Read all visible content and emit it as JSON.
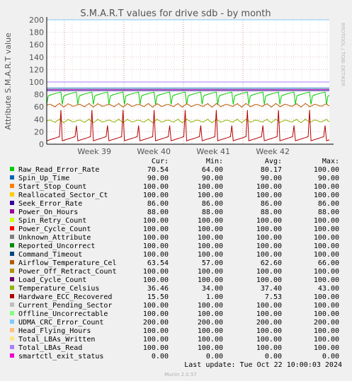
{
  "chart_data": {
    "type": "line",
    "title": "S.M.A.R.T values for drive sdb - by month",
    "ylabel": "Attribute S.M.A.R.T value",
    "watermark": "RRDTOOL / TOBI OETIKER",
    "ylim": [
      0,
      200
    ],
    "yticks": [
      0,
      20,
      40,
      60,
      80,
      100,
      120,
      140,
      160,
      180,
      200
    ],
    "xticks": [
      "Week 39",
      "Week 40",
      "Week 41",
      "Week 42"
    ],
    "grid": true,
    "legend_headers": [
      "Cur:",
      "Min:",
      "Avg:",
      "Max:"
    ],
    "series": [
      {
        "name": "Raw_Read_Error_Rate",
        "color": "#00cc00",
        "cur": "70.54",
        "min": "64.00",
        "avg": "80.17",
        "max": "100.00",
        "values": [
          {
            "base": 80.2,
            "min": 64,
            "max": 100
          }
        ]
      },
      {
        "name": "Spin_Up_Time",
        "color": "#0066b3",
        "cur": "90.00",
        "min": "90.00",
        "avg": "90.00",
        "max": "90.00",
        "values": [
          90
        ]
      },
      {
        "name": "Start_Stop_Count",
        "color": "#ff8000",
        "cur": "100.00",
        "min": "100.00",
        "avg": "100.00",
        "max": "100.00",
        "values": [
          100
        ]
      },
      {
        "name": "Reallocated_Sector_Ct",
        "color": "#ffcc00",
        "cur": "100.00",
        "min": "100.00",
        "avg": "100.00",
        "max": "100.00",
        "values": [
          100
        ]
      },
      {
        "name": "Seek_Error_Rate",
        "color": "#330099",
        "cur": "86.00",
        "min": "86.00",
        "avg": "86.00",
        "max": "86.00",
        "values": [
          86
        ]
      },
      {
        "name": "Power_On_Hours",
        "color": "#990099",
        "cur": "88.00",
        "min": "88.00",
        "avg": "88.00",
        "max": "88.00",
        "values": [
          88
        ]
      },
      {
        "name": "Spin_Retry_Count",
        "color": "#ccff00",
        "cur": "100.00",
        "min": "100.00",
        "avg": "100.00",
        "max": "100.00",
        "values": [
          100
        ]
      },
      {
        "name": "Power_Cycle_Count",
        "color": "#ff0000",
        "cur": "100.00",
        "min": "100.00",
        "avg": "100.00",
        "max": "100.00",
        "values": [
          100
        ]
      },
      {
        "name": "Unknown_Attribute",
        "color": "#808080",
        "cur": "100.00",
        "min": "100.00",
        "avg": "100.00",
        "max": "100.00",
        "values": [
          100
        ]
      },
      {
        "name": "Reported_Uncorrect",
        "color": "#008f00",
        "cur": "100.00",
        "min": "100.00",
        "avg": "100.00",
        "max": "100.00",
        "values": [
          100
        ]
      },
      {
        "name": "Command_Timeout",
        "color": "#00487d",
        "cur": "100.00",
        "min": "100.00",
        "avg": "100.00",
        "max": "100.00",
        "values": [
          100
        ]
      },
      {
        "name": "Airflow_Temperature_Cel",
        "color": "#b35a00",
        "cur": "63.54",
        "min": "57.00",
        "avg": "62.60",
        "max": "66.00",
        "values": [
          {
            "base": 62.6,
            "min": 57,
            "max": 66
          }
        ]
      },
      {
        "name": "Power_Off_Retract_Count",
        "color": "#b38f00",
        "cur": "100.00",
        "min": "100.00",
        "avg": "100.00",
        "max": "100.00",
        "values": [
          100
        ]
      },
      {
        "name": "Load_Cycle_Count",
        "color": "#6b006b",
        "cur": "100.00",
        "min": "100.00",
        "avg": "100.00",
        "max": "100.00",
        "values": [
          100
        ]
      },
      {
        "name": "Temperature_Celsius",
        "color": "#8fb300",
        "cur": "36.46",
        "min": "34.00",
        "avg": "37.40",
        "max": "43.00",
        "values": [
          {
            "base": 37.4,
            "min": 34,
            "max": 43
          }
        ]
      },
      {
        "name": "Hardware_ECC_Recovered",
        "color": "#b30000",
        "cur": "15.50",
        "min": "1.00",
        "avg": "7.53",
        "max": "100.00",
        "values": [
          {
            "base": 7.5,
            "min": 1,
            "max": 100
          }
        ]
      },
      {
        "name": "Current_Pending_Sector",
        "color": "#bebebe",
        "cur": "100.00",
        "min": "100.00",
        "avg": "100.00",
        "max": "100.00",
        "values": [
          100
        ]
      },
      {
        "name": "Offline_Uncorrectable",
        "color": "#80ff80",
        "cur": "100.00",
        "min": "100.00",
        "avg": "100.00",
        "max": "100.00",
        "values": [
          100
        ]
      },
      {
        "name": "UDMA_CRC_Error_Count",
        "color": "#80c9ff",
        "cur": "200.00",
        "min": "200.00",
        "avg": "200.00",
        "max": "200.00",
        "values": [
          200
        ]
      },
      {
        "name": "Head_Flying_Hours",
        "color": "#ffc080",
        "cur": "100.00",
        "min": "100.00",
        "avg": "100.00",
        "max": "100.00",
        "values": [
          100
        ]
      },
      {
        "name": "Total_LBAs_Written",
        "color": "#ffe680",
        "cur": "100.00",
        "min": "100.00",
        "avg": "100.00",
        "max": "100.00",
        "values": [
          100
        ]
      },
      {
        "name": "Total_LBAs_Read",
        "color": "#aa80ff",
        "cur": "100.00",
        "min": "100.00",
        "avg": "100.00",
        "max": "100.00",
        "values": [
          100
        ]
      },
      {
        "name": "smartctl_exit_status",
        "color": "#ee00cc",
        "cur": "0.00",
        "min": "0.00",
        "avg": "0.00",
        "max": "0.00",
        "values": [
          0
        ]
      }
    ],
    "last_update": "Last update: Tue Oct 22 10:00:03 2024",
    "footer": "Munin 2.0.57"
  }
}
